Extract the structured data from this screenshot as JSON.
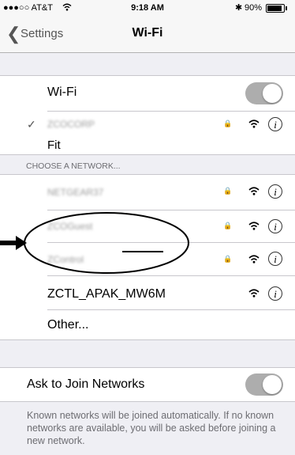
{
  "status_bar": {
    "carrier": "●●●○○ AT&T",
    "time": "9:18 AM",
    "battery": "90%"
  },
  "nav": {
    "back_label": "Settings",
    "title": "Wi-Fi"
  },
  "wifi_toggle": {
    "label": "Wi-Fi",
    "on": true
  },
  "connected_network": {
    "name": "ZCOCORP"
  },
  "overlay_label": "Fit",
  "section_header": "CHOOSE A NETWORK...",
  "networks": [
    {
      "name": "NETGEAR37",
      "secured": true
    },
    {
      "name": "ZCOGuest",
      "secured": true
    },
    {
      "name": "ZControl",
      "secured": true
    },
    {
      "name": "ZCTL_APAK_MW6M",
      "secured": false
    }
  ],
  "other_label": "Other...",
  "ask_to_join": {
    "label": "Ask to Join Networks",
    "on": true
  },
  "footer_text": "Known networks will be joined automatically. If no known networks are available, you will be asked before joining a new network.",
  "colors": {
    "toggle_track": "#adadad",
    "background": "#efeff4"
  }
}
